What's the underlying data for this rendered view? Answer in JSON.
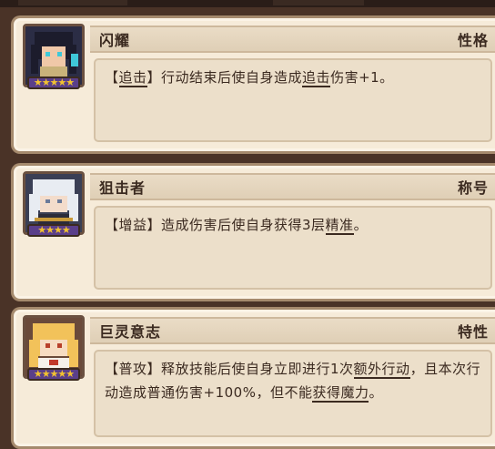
{
  "traits": [
    {
      "name": "闪耀",
      "tag": "性格",
      "stars": "★★★★★",
      "star_bg": "#5a3f8a",
      "portrait_theme": "dark-haired-character",
      "desc": {
        "prefix": "【",
        "kw1": "追击",
        "mid1": "】行动结束后使自身造成",
        "kw2": "追击",
        "suffix": "伤害+1。"
      }
    },
    {
      "name": "狙击者",
      "tag": "称号",
      "stars": "★★★★",
      "star_bg": "#5a3f8a",
      "portrait_theme": "white-haired-character",
      "desc": {
        "prefix": "【增益】造成伤害后使自身获得3层",
        "kw1": "精准",
        "suffix": "。"
      }
    },
    {
      "name": "巨灵意志",
      "tag": "特性",
      "stars": "★★★★★",
      "star_bg": "#5a3f8a",
      "portrait_theme": "blonde-haired-character",
      "desc": {
        "prefix": "【普攻】释放技能后使自身立即进行1次",
        "kw1": "额外行动",
        "mid1": "，且本次行动造成普通伤害+100%，但不能",
        "kw2": "获得魔力",
        "suffix": "。"
      }
    }
  ]
}
